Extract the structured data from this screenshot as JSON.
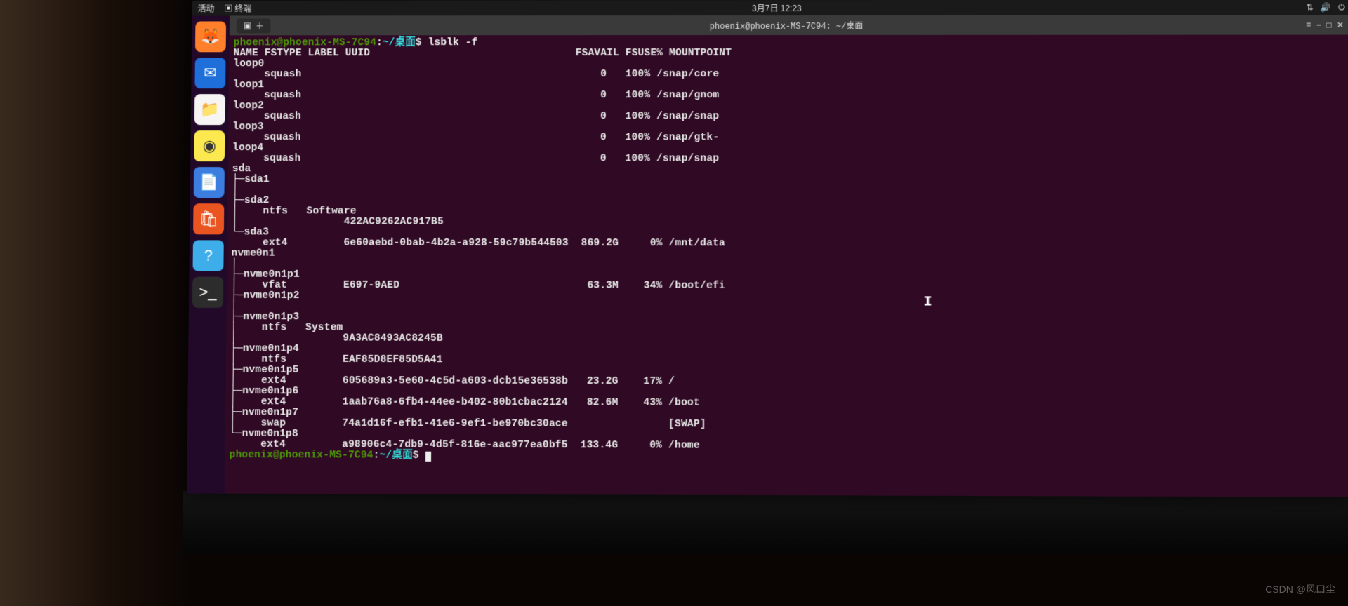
{
  "topbar": {
    "left": "活动",
    "app": "终端",
    "datetime": "3月7日 12:23"
  },
  "dock": [
    {
      "name": "firefox",
      "glyph": "🦊",
      "bg": "#ff7f2a"
    },
    {
      "name": "thunderbird",
      "glyph": "✉",
      "bg": "#1e6fd9"
    },
    {
      "name": "files",
      "glyph": "📁",
      "bg": "#f6f5f4"
    },
    {
      "name": "rhythmbox",
      "glyph": "◉",
      "bg": "#fce94f"
    },
    {
      "name": "writer",
      "glyph": "📄",
      "bg": "#3c7de0"
    },
    {
      "name": "software",
      "glyph": "🛍",
      "bg": "#e95420"
    },
    {
      "name": "help",
      "glyph": "?",
      "bg": "#3daee9"
    },
    {
      "name": "terminal",
      "glyph": ">_",
      "bg": "#2c2c2c"
    }
  ],
  "terminal": {
    "title": "phoenix@phoenix-MS-7C94: ~/桌面",
    "tab_icon": "▣",
    "prompt_user": "phoenix@phoenix-MS-7C94",
    "prompt_sep": ":",
    "prompt_path": "~/桌面",
    "prompt_end": "$",
    "command": "lsblk -f",
    "header": "NAME FSTYPE LABEL UUID                                 FSAVAIL FSUSE% MOUNTPOINT",
    "lines": [
      "loop0",
      "     squash                                                0   100% /snap/core",
      "loop1",
      "     squash                                                0   100% /snap/gnom",
      "loop2",
      "     squash                                                0   100% /snap/snap",
      "loop3",
      "     squash                                                0   100% /snap/gtk-",
      "loop4",
      "     squash                                                0   100% /snap/snap",
      "sda",
      "├─sda1",
      "│",
      "├─sda2",
      "│    ntfs   Software",
      "│                 422AC9262AC917B5",
      "└─sda3",
      "     ext4         6e60aebd-0bab-4b2a-a928-59c79b544503  869.2G     0% /mnt/data",
      "nvme0n1",
      "│",
      "├─nvme0n1p1",
      "│    vfat         E697-9AED                              63.3M    34% /boot/efi",
      "├─nvme0n1p2",
      "│",
      "├─nvme0n1p3",
      "│    ntfs   System",
      "│                 9A3AC8493AC8245B",
      "├─nvme0n1p4",
      "│    ntfs         EAF85D8EF85D5A41",
      "├─nvme0n1p5",
      "│    ext4         605689a3-5e60-4c5d-a603-dcb15e36538b   23.2G    17% /",
      "├─nvme0n1p6",
      "│    ext4         1aab76a8-6fb4-44ee-b402-80b1cbac2124   82.6M    43% /boot",
      "├─nvme0n1p7",
      "│    swap         74a1d16f-efb1-41e6-9ef1-be970bc30ace                [SWAP]",
      "└─nvme0n1p8",
      "     ext4         a98906c4-7db9-4d5f-816e-aac977ea0bf5  133.4G     0% /home"
    ]
  },
  "watermark": "CSDN @风口尘",
  "chart_data": {
    "type": "table",
    "title": "lsblk -f output",
    "columns": [
      "NAME",
      "FSTYPE",
      "LABEL",
      "UUID",
      "FSAVAIL",
      "FSUSE%",
      "MOUNTPOINT"
    ],
    "rows": [
      [
        "loop0",
        "squash",
        "",
        "",
        "0",
        "100%",
        "/snap/core"
      ],
      [
        "loop1",
        "squash",
        "",
        "",
        "0",
        "100%",
        "/snap/gnom"
      ],
      [
        "loop2",
        "squash",
        "",
        "",
        "0",
        "100%",
        "/snap/snap"
      ],
      [
        "loop3",
        "squash",
        "",
        "",
        "0",
        "100%",
        "/snap/gtk-"
      ],
      [
        "loop4",
        "squash",
        "",
        "",
        "0",
        "100%",
        "/snap/snap"
      ],
      [
        "sda",
        "",
        "",
        "",
        "",
        "",
        ""
      ],
      [
        "sda1",
        "",
        "",
        "",
        "",
        "",
        ""
      ],
      [
        "sda2",
        "ntfs",
        "Software",
        "422AC9262AC917B5",
        "",
        "",
        ""
      ],
      [
        "sda3",
        "ext4",
        "",
        "6e60aebd-0bab-4b2a-a928-59c79b544503",
        "869.2G",
        "0%",
        "/mnt/data"
      ],
      [
        "nvme0n1",
        "",
        "",
        "",
        "",
        "",
        ""
      ],
      [
        "nvme0n1p1",
        "vfat",
        "",
        "E697-9AED",
        "63.3M",
        "34%",
        "/boot/efi"
      ],
      [
        "nvme0n1p2",
        "",
        "",
        "",
        "",
        "",
        ""
      ],
      [
        "nvme0n1p3",
        "ntfs",
        "System",
        "9A3AC8493AC8245B",
        "",
        "",
        ""
      ],
      [
        "nvme0n1p4",
        "ntfs",
        "",
        "EAF85D8EF85D5A41",
        "",
        "",
        ""
      ],
      [
        "nvme0n1p5",
        "ext4",
        "",
        "605689a3-5e60-4c5d-a603-dcb15e36538b",
        "23.2G",
        "17%",
        "/"
      ],
      [
        "nvme0n1p6",
        "ext4",
        "",
        "1aab76a8-6fb4-44ee-b402-80b1cbac2124",
        "82.6M",
        "43%",
        "/boot"
      ],
      [
        "nvme0n1p7",
        "swap",
        "",
        "74a1d16f-efb1-41e6-9ef1-be970bc30ace",
        "",
        "",
        "[SWAP]"
      ],
      [
        "nvme0n1p8",
        "ext4",
        "",
        "a98906c4-7db9-4d5f-816e-aac977ea0bf5",
        "133.4G",
        "0%",
        "/home"
      ]
    ]
  }
}
